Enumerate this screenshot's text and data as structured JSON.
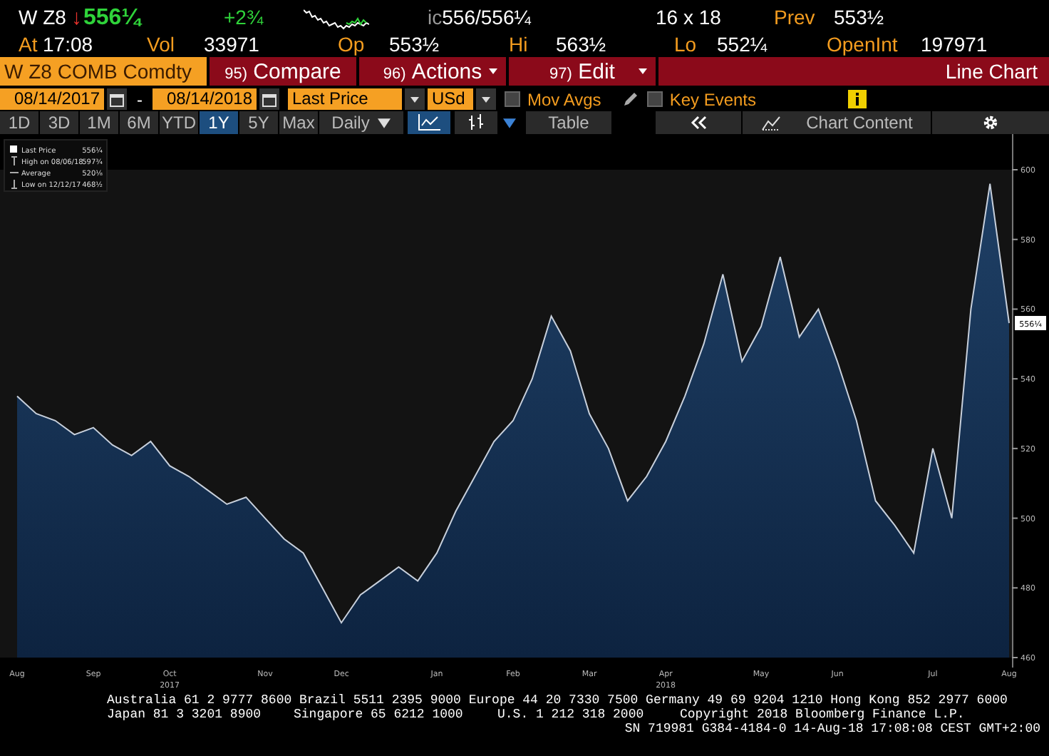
{
  "quote": {
    "ticker": "W Z8",
    "arrow": "↓",
    "last": "556¼",
    "change": "+2¾",
    "bid_prefix": "ic",
    "bid": "556",
    "ask": "/556¼",
    "size": "16 x 18",
    "prev_label": "Prev",
    "prev": "553½"
  },
  "stats": [
    {
      "label": "At",
      "value": "17:08"
    },
    {
      "label": "Vol",
      "value": "33971"
    },
    {
      "label": "Op",
      "value": "553½"
    },
    {
      "label": "Hi",
      "value": "563½"
    },
    {
      "label": "Lo",
      "value": "552¼"
    },
    {
      "label": "OpenInt",
      "value": "197971"
    }
  ],
  "toolbar": {
    "security": "W Z8 COMB Comdty",
    "menus": [
      {
        "number": "95)",
        "label": "Compare",
        "dropdown": false
      },
      {
        "number": "96)",
        "label": "Actions",
        "dropdown": true
      },
      {
        "number": "97)",
        "label": "Edit",
        "dropdown": true
      }
    ],
    "view": "Line Chart"
  },
  "controls": {
    "start_date": "08/14/2017",
    "separator": "-",
    "end_date": "08/14/2018",
    "field": "Last Price",
    "currency": "USd",
    "toggles": [
      {
        "label": "Mov Avgs",
        "checked": false
      },
      {
        "label": "Key Events",
        "checked": false
      }
    ]
  },
  "periods": [
    {
      "label": "1D",
      "selected": false
    },
    {
      "label": "3D",
      "selected": false
    },
    {
      "label": "1M",
      "selected": false
    },
    {
      "label": "6M",
      "selected": false
    },
    {
      "label": "YTD",
      "selected": false
    },
    {
      "label": "1Y",
      "selected": true
    },
    {
      "label": "5Y",
      "selected": false
    },
    {
      "label": "Max",
      "selected": false
    }
  ],
  "frequency": "Daily",
  "table_button": "Table",
  "chart_content_button": "Chart Content",
  "legend": [
    {
      "kind": "swatch",
      "value": "556¼"
    },
    {
      "kind": "high",
      "label": "High on 08/06/18",
      "value": "597¾"
    },
    {
      "kind": "average",
      "label": "Average",
      "value": "520⅛"
    },
    {
      "kind": "low",
      "label": "Low on 12/12/17",
      "value": "468½"
    }
  ],
  "price_tag": "556¼",
  "chart": {
    "chart_data": {
      "type": "area",
      "categories": [
        "Aug",
        null,
        null,
        null,
        "Sep",
        null,
        null,
        null,
        "Oct\n2017",
        null,
        null,
        null,
        null,
        "Nov",
        null,
        null,
        null,
        "Dec",
        null,
        null,
        null,
        null,
        "Jan",
        null,
        null,
        null,
        "Feb",
        null,
        null,
        null,
        "Mar",
        null,
        null,
        null,
        "Apr\n2018",
        null,
        null,
        null,
        null,
        "May",
        null,
        null,
        null,
        "Jun",
        null,
        null,
        null,
        null,
        "Jul",
        null,
        null,
        null,
        "Aug"
      ],
      "series": [
        {
          "name": "Last Price",
          "color": "#c8d0dc",
          "values": [
            535,
            530,
            528,
            524,
            526,
            521,
            518,
            522,
            515,
            512,
            508,
            504,
            506,
            500,
            494,
            490,
            480,
            470,
            478,
            482,
            486,
            482,
            490,
            502,
            512,
            522,
            528,
            540,
            558,
            548,
            530,
            520,
            505,
            512,
            522,
            535,
            550,
            570,
            545,
            555,
            575,
            552,
            560,
            545,
            528,
            505,
            498,
            490,
            520,
            500,
            560,
            596,
            556
          ]
        }
      ],
      "ylim": [
        460,
        600
      ],
      "yticks": [
        460,
        480,
        500,
        520,
        540,
        560,
        580,
        600
      ]
    }
  },
  "footer": {
    "line_1": "Australia 61 2 9777 8600 Brazil 5511 2395 9000 Europe 44 20 7330 7500 Germany 49 69 9204 1210 Hong Kong 852 2977 6000",
    "line_2": [
      "Japan 81 3 3201 8900",
      "Singapore 65 6212 1000",
      "U.S. 1 212 318 2000",
      "Copyright 2018 Bloomberg Finance L.P."
    ],
    "line_3": "SN 719981 G384-4184-0 14-Aug-18 17:08:08 CEST GMT+2:00"
  }
}
